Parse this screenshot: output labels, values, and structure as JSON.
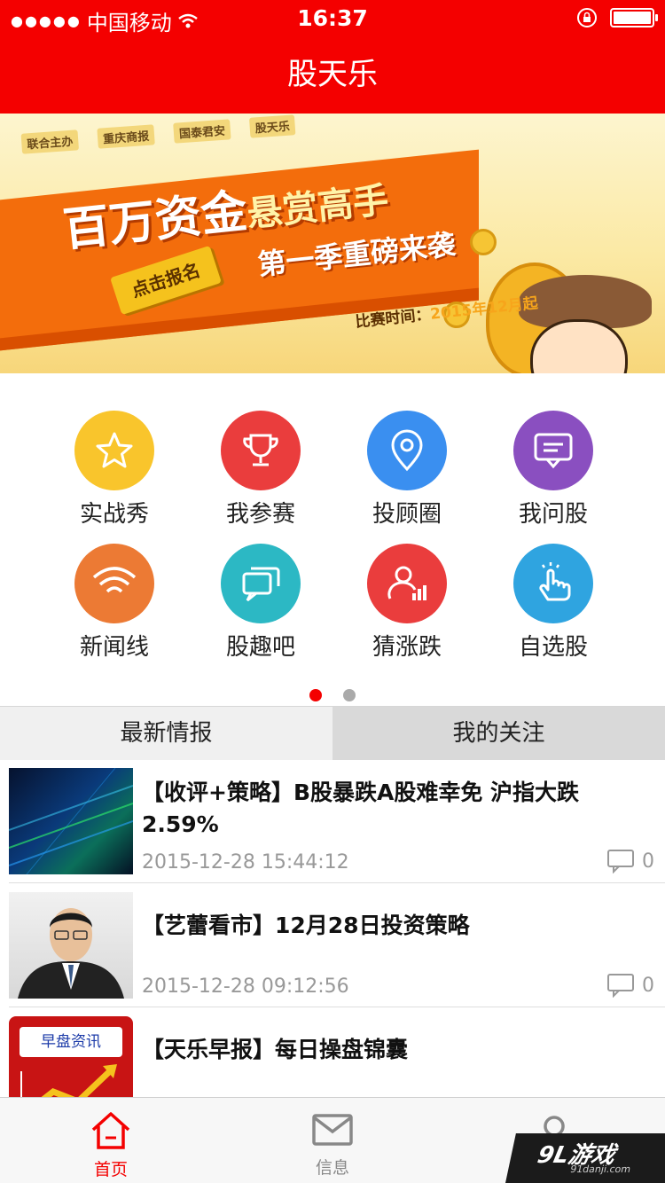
{
  "statusbar": {
    "carrier": "中国移动",
    "time": "16:37"
  },
  "nav": {
    "title": "股天乐"
  },
  "banner": {
    "sponsors": [
      "联合主办",
      "重庆商报",
      "国泰君安",
      "股天乐"
    ],
    "headline_big": "百万资金",
    "headline_small": "悬赏高手",
    "subheadline": "第一季重磅来袭",
    "cta": "点击报名",
    "date_label": "比赛时间：",
    "date_value": "2015年12月起"
  },
  "grid": {
    "items": [
      {
        "label": "实战秀",
        "icon": "star-icon",
        "color": "#f9c52c"
      },
      {
        "label": "我参赛",
        "icon": "trophy-icon",
        "color": "#ea3d3d"
      },
      {
        "label": "投顾圈",
        "icon": "location-pin-icon",
        "color": "#3a8ff0"
      },
      {
        "label": "我问股",
        "icon": "message-icon",
        "color": "#8a4fc0"
      },
      {
        "label": "新闻线",
        "icon": "wifi-icon",
        "color": "#ec7a34"
      },
      {
        "label": "股趣吧",
        "icon": "chat-bubbles-icon",
        "color": "#2cb8c4"
      },
      {
        "label": "猜涨跌",
        "icon": "user-chart-icon",
        "color": "#ea3d3d"
      },
      {
        "label": "自选股",
        "icon": "tap-hand-icon",
        "color": "#2fa4e0"
      }
    ],
    "page_count": 2,
    "current_page": 1
  },
  "tabs": {
    "latest": "最新情报",
    "following": "我的关注"
  },
  "news": [
    {
      "title": "【收评+策略】B股暴跌A股难幸免 沪指大跌2.59%",
      "time": "2015-12-28 15:44:12",
      "comments": "0"
    },
    {
      "title": "【艺蕾看市】12月28日投资策略",
      "time": "2015-12-28 09:12:56",
      "comments": "0"
    },
    {
      "title": "【天乐早报】每日操盘锦囊",
      "thumb_text": "早盘资讯"
    }
  ],
  "bottombar": {
    "home": "首页",
    "messages": "信息"
  },
  "watermark": {
    "main": "9L游戏",
    "sub": "91danji.com"
  },
  "colors": {
    "brand_red": "#f40000",
    "active_tab": "#f40000",
    "inactive_tab": "#999999"
  }
}
